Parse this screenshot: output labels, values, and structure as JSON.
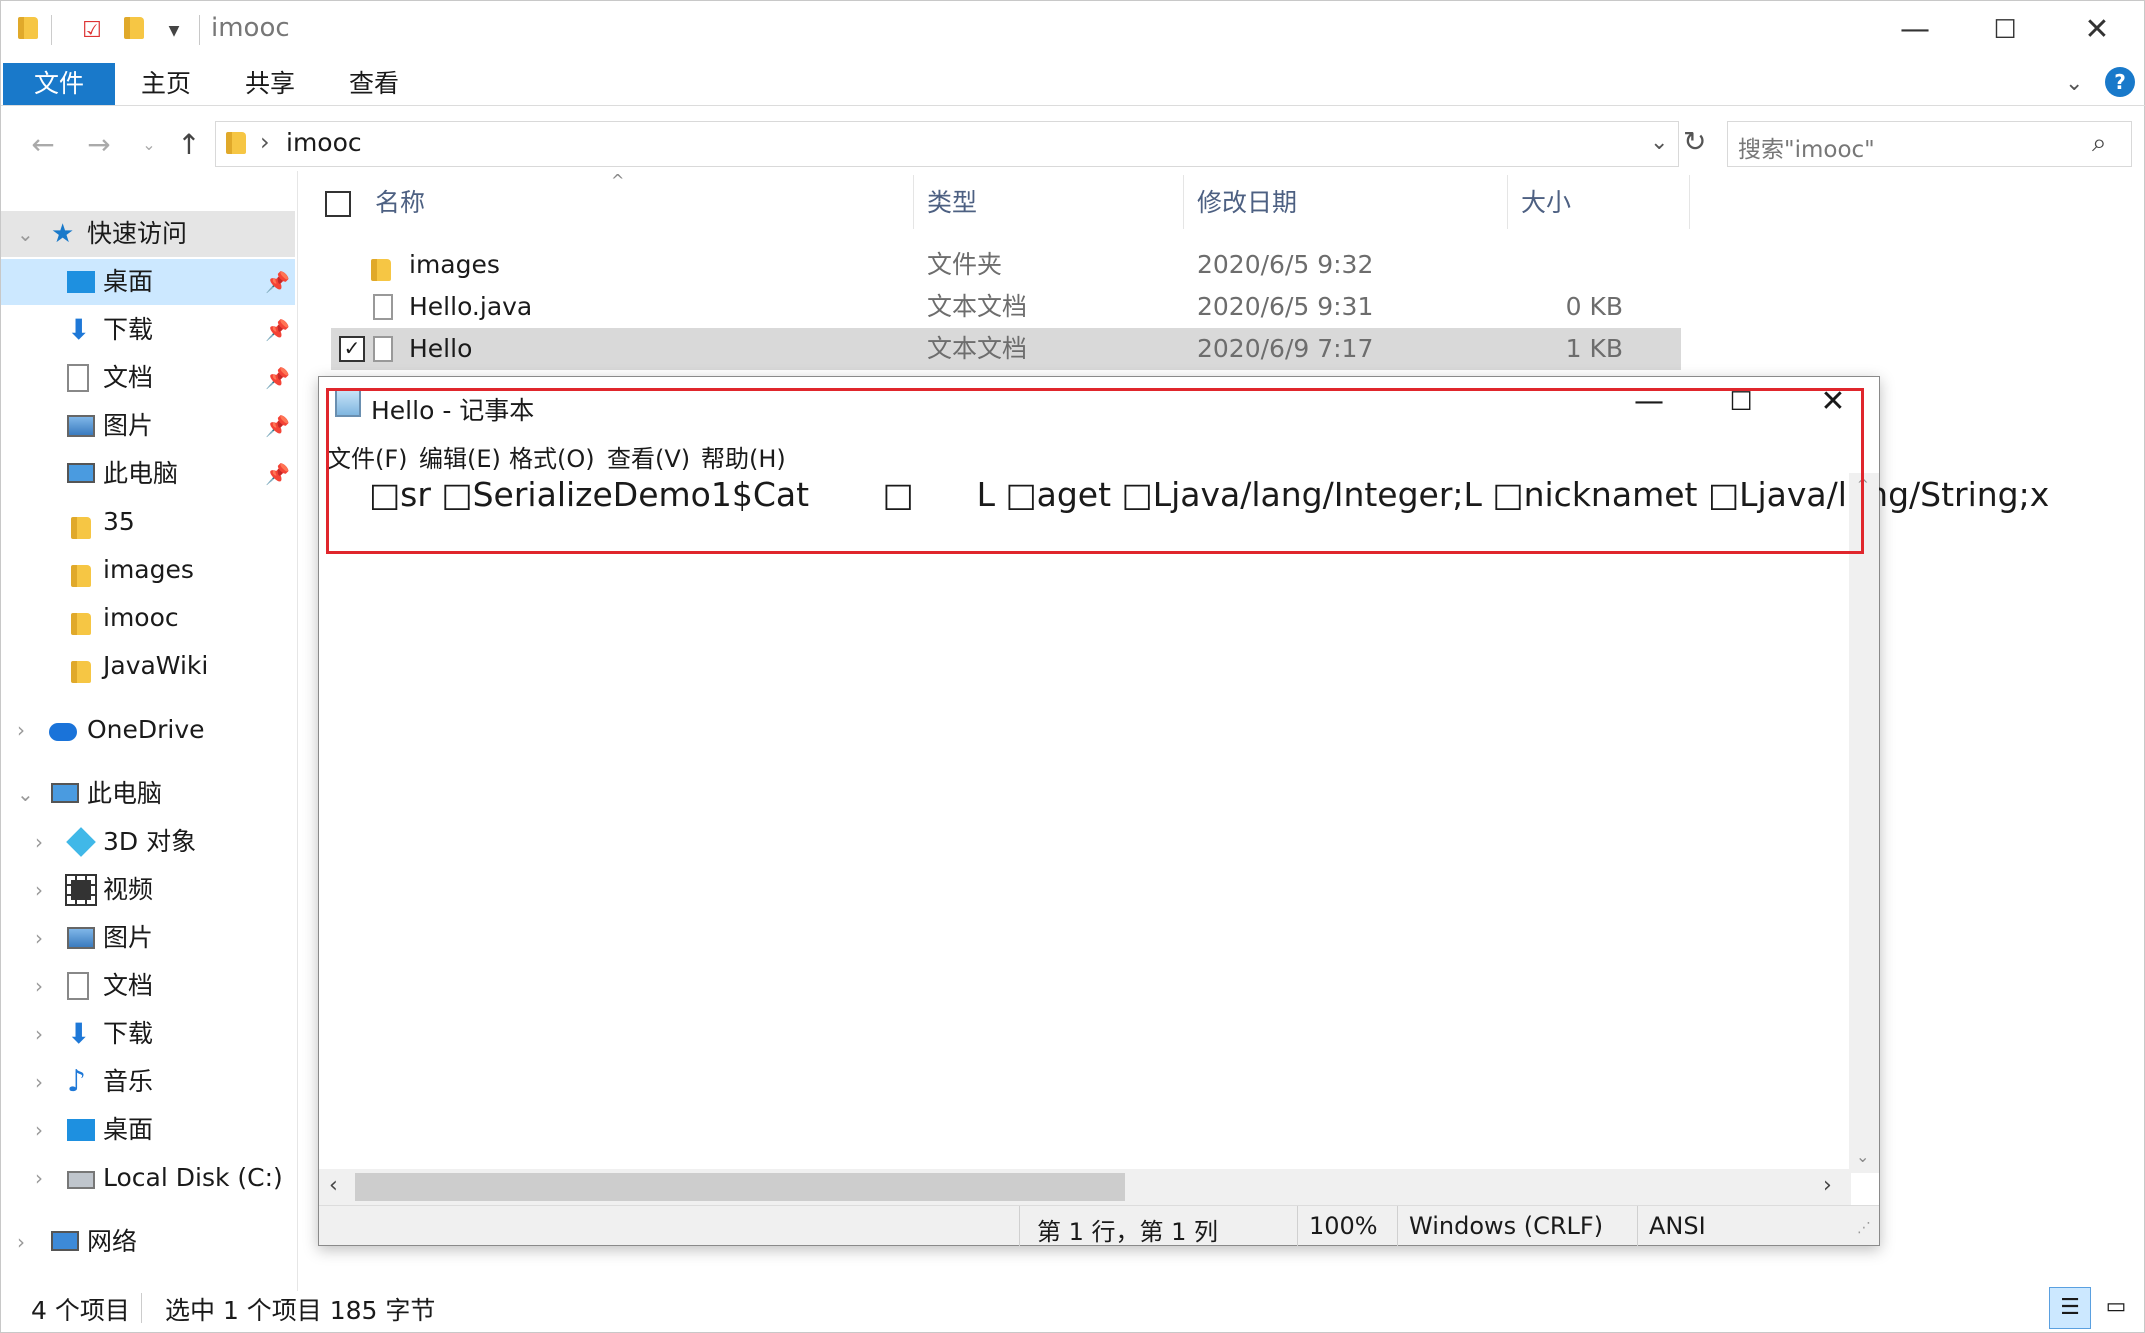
{
  "window": {
    "title": "imooc",
    "minimize": "—",
    "maximize": "☐",
    "close": "✕"
  },
  "ribbon": {
    "tabs": [
      "文件",
      "主页",
      "共享",
      "查看"
    ],
    "help": "?"
  },
  "address": {
    "path_sep": "›",
    "path": "imooc",
    "search_placeholder": "搜索\"imooc\""
  },
  "sidebar": {
    "quick_access": "快速访问",
    "items": [
      {
        "label": "桌面",
        "icon": "desktop-icon"
      },
      {
        "label": "下载",
        "icon": "download-icon"
      },
      {
        "label": "文档",
        "icon": "document-icon"
      },
      {
        "label": "图片",
        "icon": "pictures-icon"
      },
      {
        "label": "此电脑",
        "icon": "computer-icon"
      },
      {
        "label": "35",
        "icon": "folder-icon"
      },
      {
        "label": "images",
        "icon": "folder-icon"
      },
      {
        "label": "imooc",
        "icon": "folder-icon"
      },
      {
        "label": "JavaWiki",
        "icon": "folder-icon"
      }
    ],
    "onedrive": "OneDrive",
    "this_pc": "此电脑",
    "pc_items": [
      {
        "label": "3D 对象",
        "icon": "3d-objects-icon"
      },
      {
        "label": "视频",
        "icon": "videos-icon"
      },
      {
        "label": "图片",
        "icon": "pictures-icon"
      },
      {
        "label": "文档",
        "icon": "document-icon"
      },
      {
        "label": "下载",
        "icon": "download-icon"
      },
      {
        "label": "音乐",
        "icon": "music-icon"
      },
      {
        "label": "桌面",
        "icon": "desktop-icon"
      },
      {
        "label": "Local Disk (C:)",
        "icon": "disk-icon"
      }
    ],
    "network": "网络"
  },
  "files": {
    "columns": [
      "名称",
      "类型",
      "修改日期",
      "大小"
    ],
    "rows": [
      {
        "name": "images",
        "type": "文件夹",
        "date": "2020/6/5 9:32",
        "size": ""
      },
      {
        "name": "Hello.java",
        "type": "文本文档",
        "date": "2020/6/5 9:31",
        "size": "0 KB"
      },
      {
        "name": "Hello",
        "type": "文本文档",
        "date": "2020/6/9 7:17",
        "size": "1 KB"
      }
    ]
  },
  "status": {
    "count": "4 个项目",
    "selection": "选中 1 个项目  185 字节"
  },
  "notepad": {
    "title": "Hello - 记事本",
    "menu": [
      "文件(F)",
      "编辑(E)",
      "格式(O)",
      "查看(V)",
      "帮助(H)"
    ],
    "content": "□sr □SerializeDemo1$Cat       □      L □aget □Ljava/lang/Integer;L □nicknamet □Ljava/lang/String;x",
    "status": {
      "position": "第 1 行，第 1 列",
      "zoom": "100%",
      "line_ending": "Windows (CRLF)",
      "encoding": "ANSI"
    }
  },
  "colors": {
    "accent": "#1979ca",
    "highlight_border": "#e0262c",
    "selection": "#cce8ff"
  }
}
